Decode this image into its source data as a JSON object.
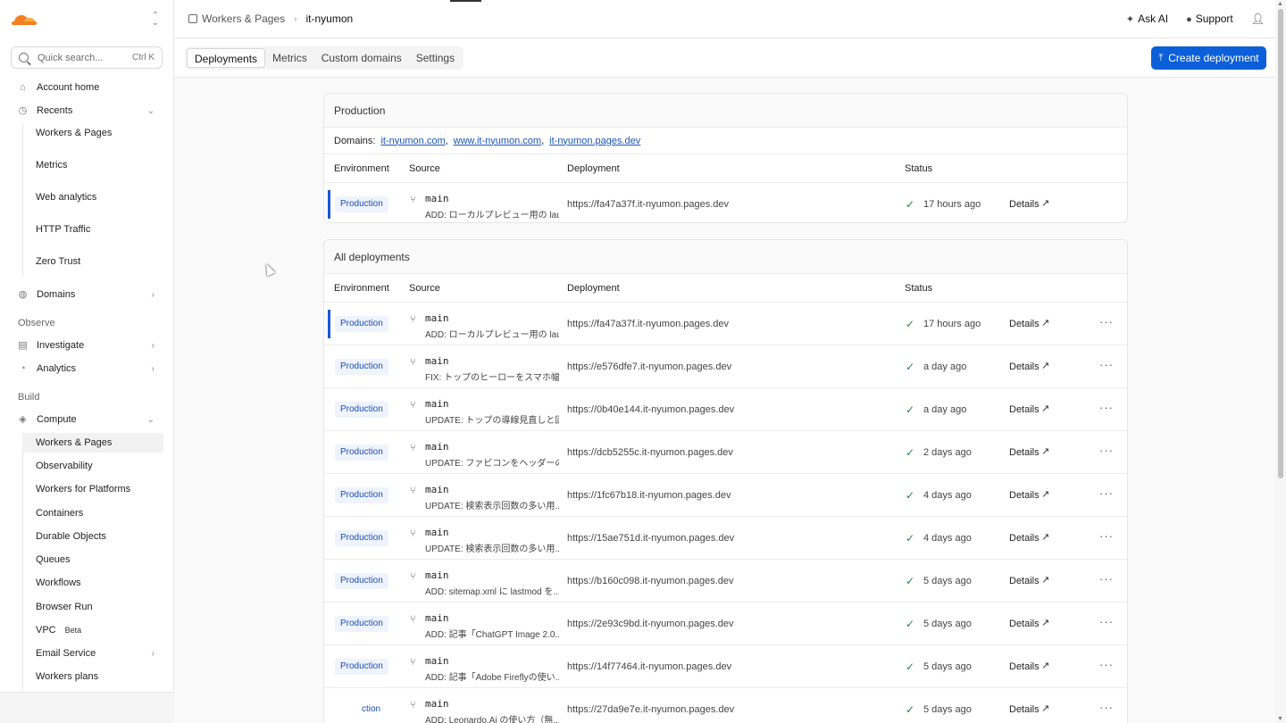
{
  "sidebar": {
    "search_placeholder": "Quick search...",
    "search_shortcut": "Ctrl K",
    "account_home": "Account home",
    "recents": "Recents",
    "recent_items": [
      "Workers & Pages",
      "Metrics",
      "Web analytics",
      "HTTP Traffic",
      "Zero Trust"
    ],
    "domains": "Domains",
    "observe_label": "Observe",
    "investigate": "Investigate",
    "analytics": "Analytics",
    "build_label": "Build",
    "compute": "Compute",
    "compute_items": [
      "Workers & Pages",
      "Observability",
      "Workers for Platforms",
      "Containers",
      "Durable Objects",
      "Queues",
      "Workflows",
      "Browser Run",
      "VPC",
      "Email Service",
      "Workers plans"
    ],
    "beta": "Beta"
  },
  "header": {
    "breadcrumb_section": "Workers & Pages",
    "breadcrumb_project": "it-nyumon",
    "ask_ai": "Ask AI",
    "support": "Support"
  },
  "tabs": [
    "Deployments",
    "Metrics",
    "Custom domains",
    "Settings"
  ],
  "create_button": "Create deployment",
  "production": {
    "title": "Production",
    "domains_label": "Domains:",
    "domains": [
      "it-nyumon.com",
      "www.it-nyumon.com",
      "it-nyumon.pages.dev"
    ],
    "columns": [
      "Environment",
      "Source",
      "Deployment",
      "Status"
    ],
    "row": {
      "env": "Production",
      "branch": "main",
      "msg": "ADD: ローカルプレビュー用の launch...",
      "url": "https://fa47a37f.it-nyumon.pages.dev",
      "status": "17 hours ago",
      "details": "Details"
    }
  },
  "all": {
    "title": "All deployments",
    "columns": [
      "Environment",
      "Source",
      "Deployment",
      "Status"
    ],
    "rows": [
      {
        "env": "Production",
        "branch": "main",
        "msg": "ADD: ローカルプレビュー用の launch...",
        "url": "https://fa47a37f.it-nyumon.pages.dev",
        "status": "17 hours ago",
        "details": "Details"
      },
      {
        "env": "Production",
        "branch": "main",
        "msg": "FIX: トップのヒーローをスマホ幅でコン...",
        "url": "https://e576dfe7.it-nyumon.pages.dev",
        "status": "a day ago",
        "details": "Details"
      },
      {
        "env": "Production",
        "branch": "main",
        "msg": "UPDATE: トップの導線見直しと固...",
        "url": "https://0b40e144.it-nyumon.pages.dev",
        "status": "a day ago",
        "details": "Details"
      },
      {
        "env": "Production",
        "branch": "main",
        "msg": "UPDATE: ファビコンをヘッダーの路線...",
        "url": "https://dcb5255c.it-nyumon.pages.dev",
        "status": "2 days ago",
        "details": "Details"
      },
      {
        "env": "Production",
        "branch": "main",
        "msg": "UPDATE: 検索表示回数の多い用...",
        "url": "https://1fc67b18.it-nyumon.pages.dev",
        "status": "4 days ago",
        "details": "Details"
      },
      {
        "env": "Production",
        "branch": "main",
        "msg": "UPDATE: 検索表示回数の多い用...",
        "url": "https://15ae751d.it-nyumon.pages.dev",
        "status": "4 days ago",
        "details": "Details"
      },
      {
        "env": "Production",
        "branch": "main",
        "msg": "ADD: sitemap.xml に lastmod を...",
        "url": "https://b160c098.it-nyumon.pages.dev",
        "status": "5 days ago",
        "details": "Details"
      },
      {
        "env": "Production",
        "branch": "main",
        "msg": "ADD: 記事「ChatGPT Image 2.0...",
        "url": "https://2e93c9bd.it-nyumon.pages.dev",
        "status": "5 days ago",
        "details": "Details"
      },
      {
        "env": "Production",
        "branch": "main",
        "msg": "ADD: 記事「Adobe Fireflyの使い...",
        "url": "https://14f77464.it-nyumon.pages.dev",
        "status": "5 days ago",
        "details": "Details"
      },
      {
        "env": "ction",
        "branch": "main",
        "msg": "ADD: Leonardo.Ai の使い方（無...",
        "url": "https://27da9e7e.it-nyumon.pages.dev",
        "status": "5 days ago",
        "details": "Details"
      }
    ]
  },
  "colors": {
    "accent": "#0b5fd8",
    "badge_bg": "#eef3fd",
    "success": "#1e8a45",
    "brand": "#f38020"
  }
}
